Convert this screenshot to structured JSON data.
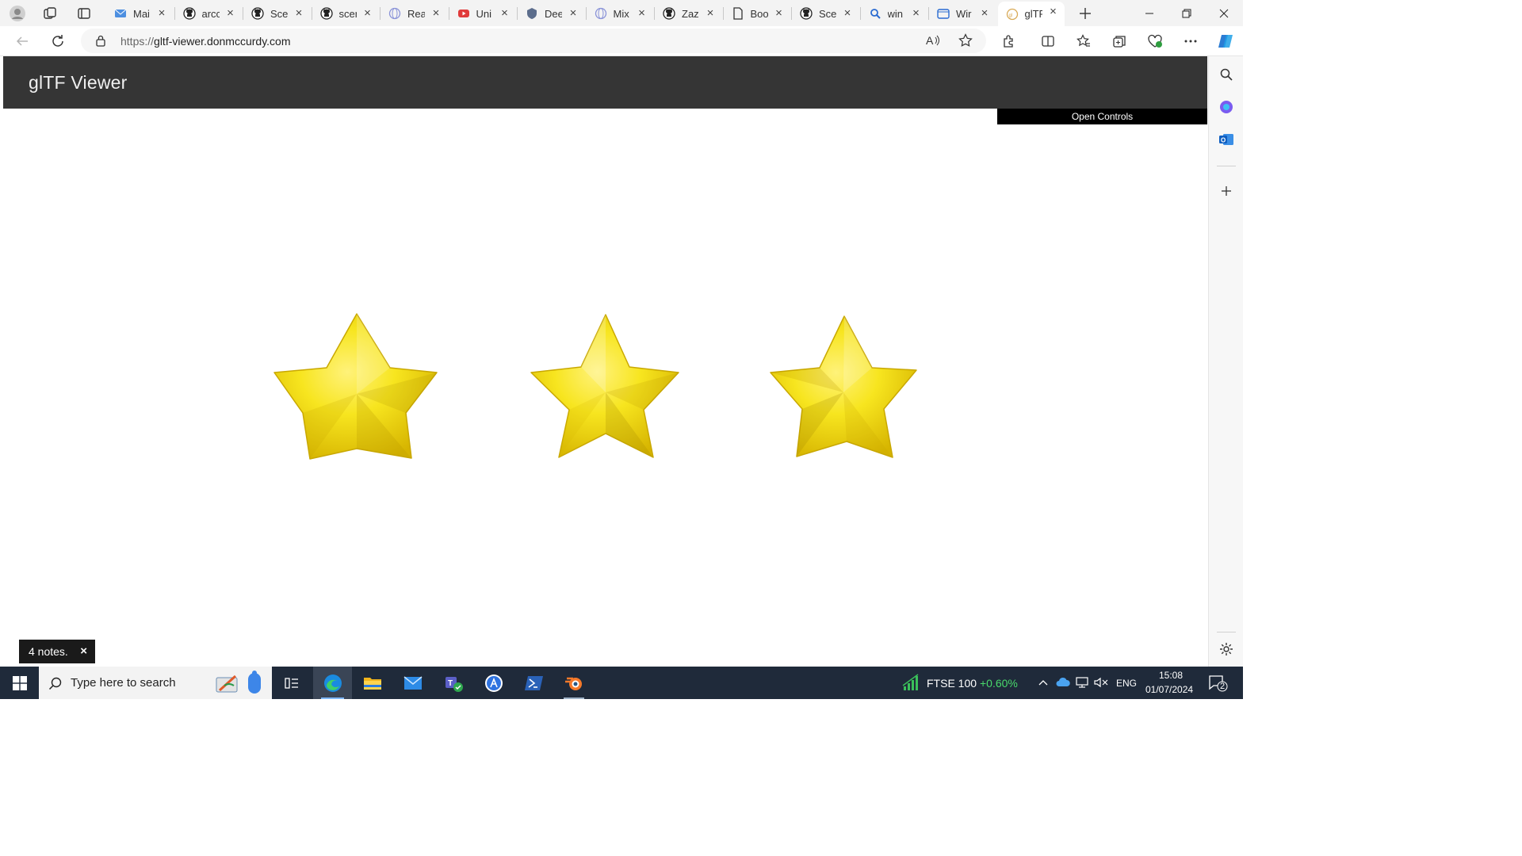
{
  "browser": {
    "tabs": [
      {
        "title": "Mai",
        "icon": "mail-icon"
      },
      {
        "title": "arcc",
        "icon": "github-icon"
      },
      {
        "title": "Scei",
        "icon": "github-icon"
      },
      {
        "title": "scer",
        "icon": "github-icon"
      },
      {
        "title": "Rea",
        "icon": "globe-icon"
      },
      {
        "title": "Uni",
        "icon": "youtube-icon"
      },
      {
        "title": "Dee",
        "icon": "shield-icon"
      },
      {
        "title": "Mix",
        "icon": "globe-icon"
      },
      {
        "title": "Zaz",
        "icon": "github-icon"
      },
      {
        "title": "Boo",
        "icon": "document-icon"
      },
      {
        "title": "Scei",
        "icon": "github-icon"
      },
      {
        "title": "win",
        "icon": "search-icon"
      },
      {
        "title": "Wir",
        "icon": "window-icon"
      },
      {
        "title": "glTF",
        "icon": "gltf-icon",
        "active": true
      }
    ],
    "url_protocol": "https://",
    "url_host": "gltf-viewer.donmccurdy.com"
  },
  "page": {
    "app_title": "glTF Viewer",
    "open_controls_label": "Open Controls",
    "notes_label": "4 notes.",
    "notes_close": "×",
    "accent_header": "#353535",
    "star_color": "#f5e21e"
  },
  "taskbar": {
    "search_placeholder": "Type here to search",
    "stock_name": "FTSE 100",
    "stock_change": "+0.60%",
    "language": "ENG",
    "time": "15:08",
    "date": "01/07/2024",
    "notification_count": "2"
  }
}
